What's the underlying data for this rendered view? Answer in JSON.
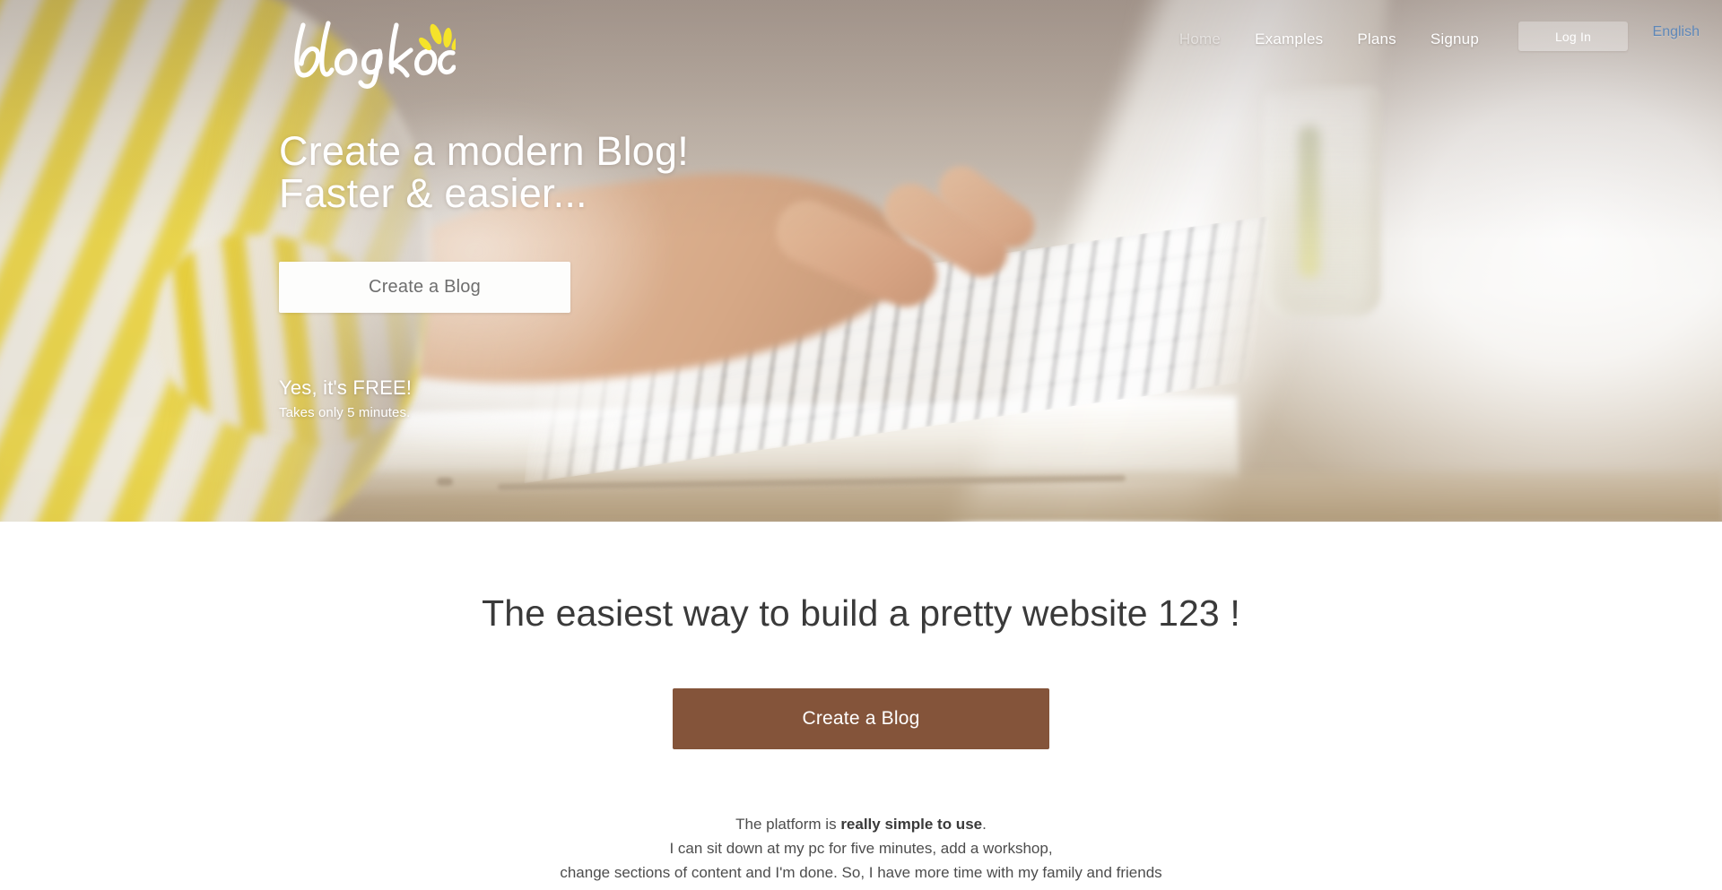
{
  "brand": {
    "name": "blogkoo",
    "logo_text": "blogkoo",
    "petal_color": "#f5e32a",
    "logo_color": "#ffffff"
  },
  "nav": {
    "links": [
      {
        "label": "Home",
        "active": true
      },
      {
        "label": "Examples",
        "active": false
      },
      {
        "label": "Plans",
        "active": false
      },
      {
        "label": "Signup",
        "active": false
      }
    ],
    "login_label": "Log In",
    "language_label": "English",
    "language_color": "#5e87b8"
  },
  "hero": {
    "title_line1": "Create a modern Blog!",
    "title_line2": "Faster & easier...",
    "cta_label": "Create a Blog",
    "free_label": "Yes, it's FREE!",
    "sub_label": "Takes only 5 minutes."
  },
  "main": {
    "heading": "The easiest way to build a pretty website 123 !",
    "cta_label": "Create a Blog",
    "cta_color": "#84543a",
    "testimonial": {
      "line1_prefix": "The platform is ",
      "line1_bold": "really simple to use",
      "line1_suffix": ".",
      "line2": "I can sit down at my pc for five minutes, add a workshop,",
      "line3": "change sections of content and I'm done. So, I have more time with my family and friends"
    }
  }
}
